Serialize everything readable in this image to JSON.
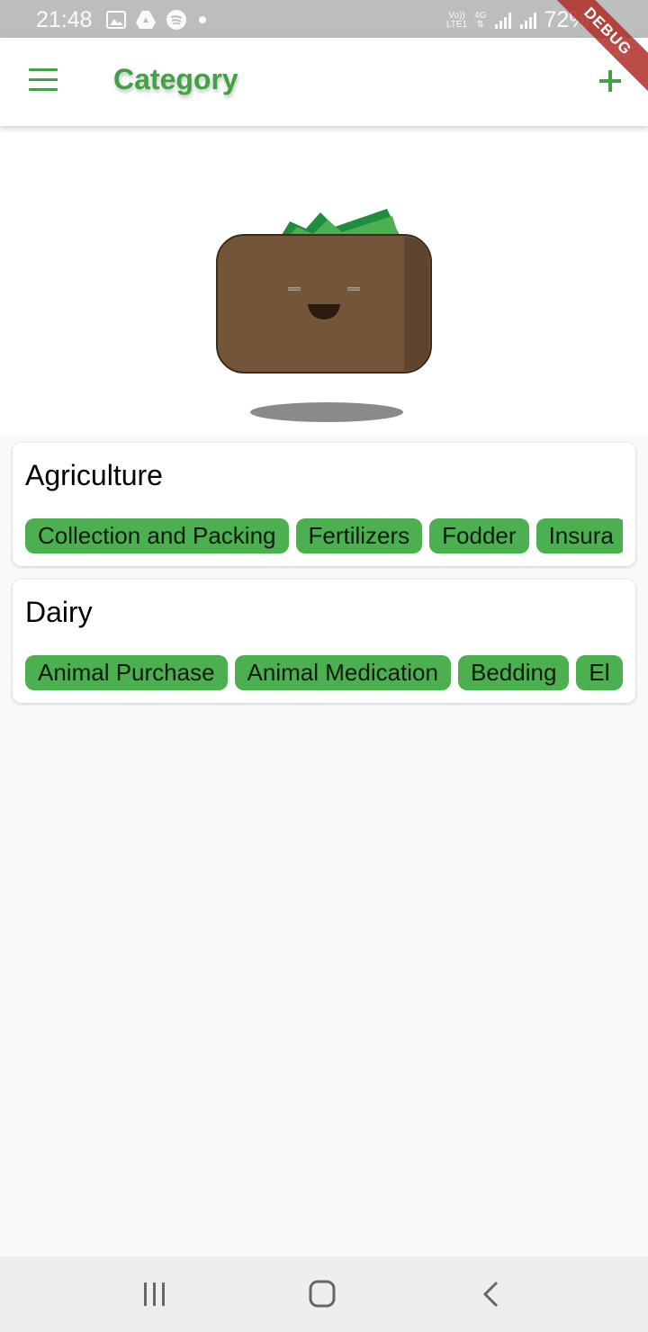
{
  "status_bar": {
    "time": "21:48",
    "network_top": "Vo))",
    "network_bottom": "LTE1",
    "data_type": "4G",
    "battery": "72%"
  },
  "debug_banner": "DEBUG",
  "app_bar": {
    "title": "Category",
    "menu_icon": "menu-icon",
    "add_icon": "add-icon"
  },
  "colors": {
    "accent": "#43a047",
    "chip": "#4caf50",
    "wallet": "#73553a"
  },
  "categories": [
    {
      "name": "Agriculture",
      "subcategories": [
        "Collection and Packing",
        "Fertilizers",
        "Fodder",
        "Insura"
      ]
    },
    {
      "name": "Dairy",
      "subcategories": [
        "Animal Purchase",
        "Animal Medication",
        "Bedding",
        "El"
      ]
    }
  ],
  "nav_bar": {
    "recents_icon": "recents-icon",
    "home_icon": "home-icon",
    "back_icon": "back-icon"
  }
}
